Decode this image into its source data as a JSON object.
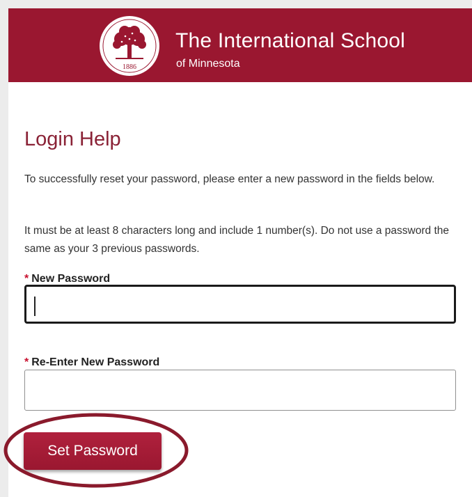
{
  "header": {
    "school_name": "The International School",
    "school_sub": "of Minnesota",
    "logo_year": "1886",
    "logo_icon": "tree-seal-icon",
    "brand_color": "#9a1730"
  },
  "page": {
    "title": "Login Help",
    "instructions": "To successfully reset your password, please enter a new password in the fields below.",
    "requirements": "It must be at least 8 characters long and include 1 number(s). Do not use a password the same as your 3 previous passwords."
  },
  "form": {
    "required_marker": "*",
    "new_password_label": "New Password",
    "new_password_value": "",
    "reenter_label": "Re-Enter New Password",
    "reenter_value": "",
    "submit_label": "Set Password"
  },
  "annotation": {
    "highlight_color": "#8a1a2c"
  }
}
